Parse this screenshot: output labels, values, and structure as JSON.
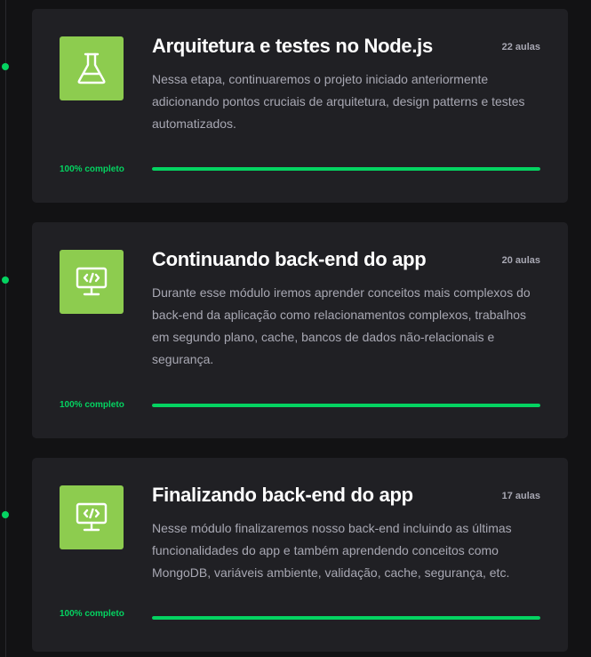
{
  "colors": {
    "background": "#121214",
    "card": "#202024",
    "icon_bg": "#8dcc4f",
    "accent_green": "#04d361",
    "title": "#ffffff",
    "muted_text": "#a8a8b3"
  },
  "modules": [
    {
      "icon": "flask-icon",
      "title": "Arquitetura e testes no Node.js",
      "lessons": "22 aulas",
      "description": "Nessa etapa, continuaremos o projeto iniciado anteriormente adicionando pontos cruciais de arquitetura, design patterns e testes automatizados.",
      "progress_label": "100% completo",
      "progress": 1.0
    },
    {
      "icon": "monitor-code-icon",
      "title": "Continuando back-end do app",
      "lessons": "20 aulas",
      "description": "Durante esse módulo iremos aprender conceitos mais complexos do back-end da aplicação como relacionamentos complexos, trabalhos em segundo plano, cache, bancos de dados não-relacionais e segurança.",
      "progress_label": "100% completo",
      "progress": 1.0
    },
    {
      "icon": "monitor-code-icon",
      "title": "Finalizando back-end do app",
      "lessons": "17 aulas",
      "description": "Nesse módulo finalizaremos nosso back-end incluindo as últimas funcionalidades do app e também aprendendo conceitos como MongoDB, variáveis ambiente, validação, cache, segurança, etc.",
      "progress_label": "100% completo",
      "progress": 1.0
    }
  ]
}
